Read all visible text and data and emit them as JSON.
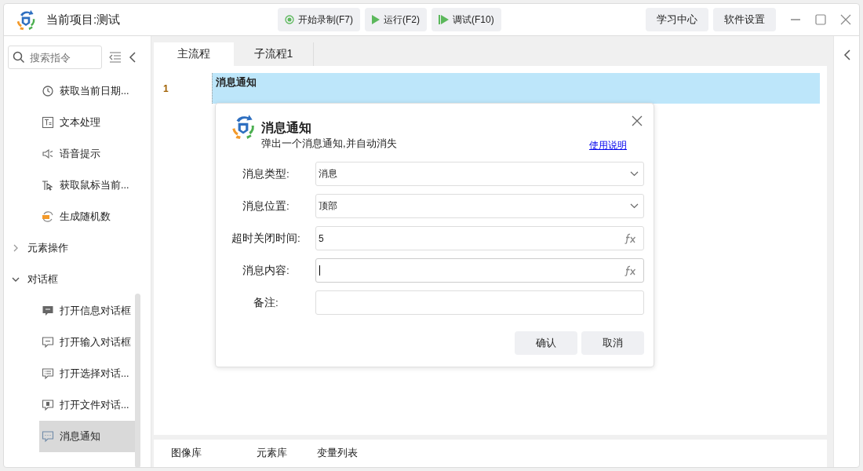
{
  "window": {
    "title": "当前项目:测试"
  },
  "toolbar": [
    {
      "kind": "record",
      "label": "开始录制(F7)"
    },
    {
      "kind": "run",
      "label": "运行(F2)"
    },
    {
      "kind": "debug",
      "label": "调试(F10)"
    }
  ],
  "header_buttons": [
    "学习中心",
    "软件设置"
  ],
  "sidebar": {
    "search": {
      "placeholder": "搜索指令"
    },
    "items": [
      {
        "label": "获取当前日期...",
        "selected": false
      },
      {
        "label": "文本处理",
        "selected": false
      },
      {
        "label": "语音提示",
        "selected": false
      },
      {
        "label": "获取鼠标当前...",
        "selected": false
      },
      {
        "label": "生成随机数",
        "selected": false
      },
      {
        "label": "元素操作",
        "expanded": false
      },
      {
        "label": "对话框",
        "expanded": true,
        "children": [
          {
            "label": "打开信息对话框",
            "selected": false
          },
          {
            "label": "打开输入对话框",
            "selected": false
          },
          {
            "label": "打开选择对话...",
            "selected": false
          },
          {
            "label": "打开文件对话...",
            "selected": false
          },
          {
            "label": "消息通知",
            "selected": true
          }
        ]
      }
    ]
  },
  "tabs": [
    {
      "label": "主流程",
      "selected": true
    },
    {
      "label": "子流程1",
      "selected": false
    }
  ],
  "editor": {
    "lines": [
      {
        "number": "1",
        "text": "消息通知",
        "selected": true
      }
    ]
  },
  "dialog": {
    "title": "消息通知",
    "subtitle": "弹出一个消息通知,并自动消失",
    "help_link": "使用说明",
    "fields": [
      {
        "label": "消息类型:",
        "kind": "select",
        "value": "消息",
        "focused": false
      },
      {
        "label": "消息位置:",
        "kind": "select",
        "value": "顶部",
        "focused": false
      },
      {
        "label": "超时关闭时间:",
        "kind": "expression",
        "value": "5",
        "focused": false
      },
      {
        "label": "消息内容:",
        "kind": "expression",
        "focused": true
      },
      {
        "label": "备注:",
        "kind": "text",
        "focused": false
      }
    ],
    "buttons": [
      "确认",
      "取消"
    ]
  },
  "bottom_tabs": [
    "图像库",
    "元素库",
    "变量列表"
  ]
}
